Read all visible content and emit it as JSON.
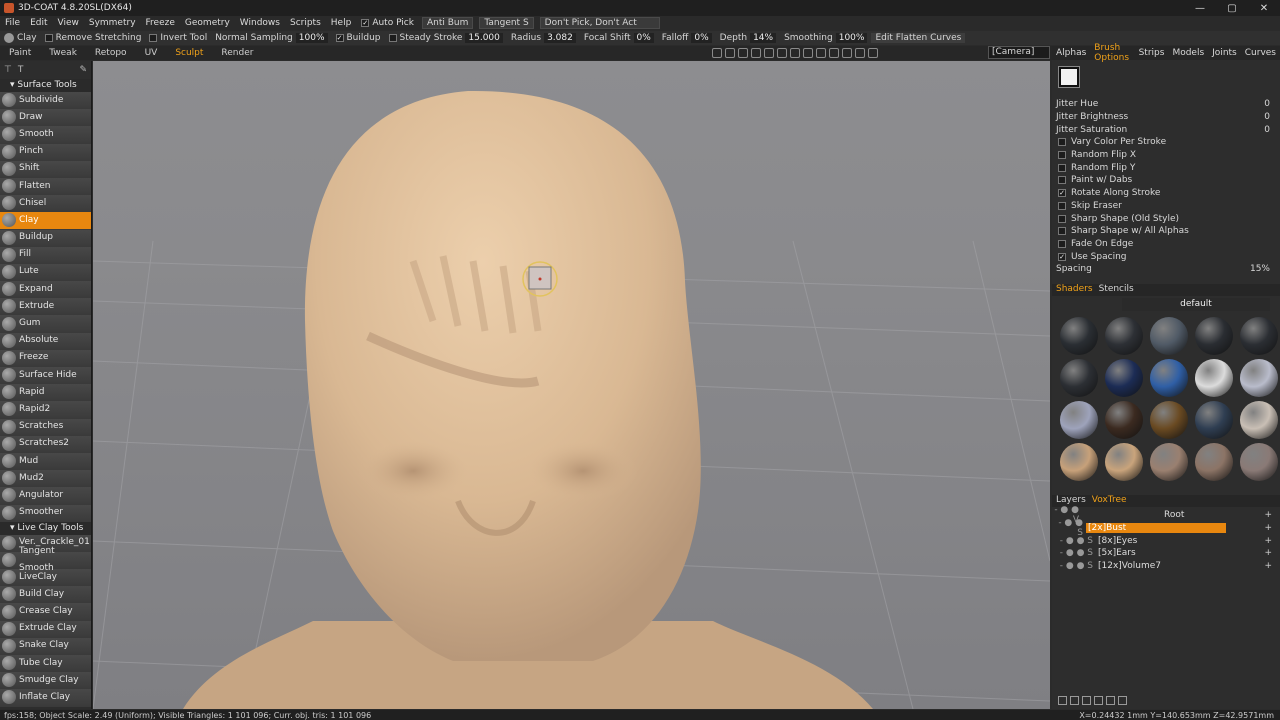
{
  "window": {
    "title": "3D-COAT 4.8.20SL(DX64)",
    "controls": [
      "—",
      "▢",
      "✕"
    ]
  },
  "menu": [
    "File",
    "Edit",
    "View",
    "Symmetry",
    "Freeze",
    "Geometry",
    "Windows",
    "Scripts",
    "Help"
  ],
  "menu_extra": {
    "auto_pick": "Auto Pick",
    "anti_bump": "Anti Bum",
    "tangent": "Tangent S",
    "pick_mode": "Don't Pick, Don't Act"
  },
  "tool_options": {
    "tool": "Clay",
    "remove_stretching": "Remove Stretching",
    "invert_tool": "Invert Tool",
    "normal_sampling": "Normal Sampling",
    "normal_sampling_val": "100%",
    "buildup": "Buildup",
    "steady_stroke": "Steady Stroke",
    "steady_stroke_val": "15.000",
    "radius": "Radius",
    "radius_val": "3.082",
    "focal_shift": "Focal Shift",
    "focal_shift_val": "0%",
    "falloff": "Falloff",
    "falloff_val": "0%",
    "depth": "Depth",
    "depth_val": "14%",
    "smoothing": "Smoothing",
    "smoothing_val": "100%",
    "edit_flatten": "Edit Flatten Curves"
  },
  "rooms": [
    "Paint",
    "Tweak",
    "Retopo",
    "UV",
    "Sculpt",
    "Render"
  ],
  "active_room": "Sculpt",
  "camera": "[Camera]",
  "left_panel": {
    "section1": "Surface Tools",
    "surface_tools": [
      "Subdivide",
      "Draw",
      "Smooth",
      "Pinch",
      "Shift",
      "Flatten",
      "Chisel",
      "Clay",
      "Buildup",
      "Fill",
      "Lute",
      "Expand",
      "Extrude",
      "Gum",
      "Absolute",
      "Freeze",
      "Surface Hide",
      "Rapid",
      "Rapid2",
      "Scratches",
      "Scratches2",
      "Mud",
      "Mud2",
      "Angulator",
      "Smoother"
    ],
    "active_tool": "Clay",
    "section2": "Live Clay Tools",
    "live_clay_tools": [
      "Ver._Crackle_01",
      "Tangent Smooth",
      "LiveClay",
      "Build Clay",
      "Crease Clay",
      "Extrude Clay",
      "Snake Clay",
      "Tube Clay",
      "Smudge Clay",
      "Inflate Clay"
    ]
  },
  "right_panel": {
    "tabs": [
      "Alphas",
      "Brush Options",
      "Strips",
      "Models",
      "Joints",
      "Curves"
    ],
    "active_tab": "Brush Options",
    "props": [
      {
        "label": "Jitter Hue",
        "value": "0"
      },
      {
        "label": "Jitter Brightness",
        "value": "0"
      },
      {
        "label": "Jitter Saturation",
        "value": "0"
      }
    ],
    "checks": [
      {
        "label": "Vary Color Per Stroke",
        "checked": false
      },
      {
        "label": "Random Flip X",
        "checked": false
      },
      {
        "label": "Random Flip Y",
        "checked": false
      },
      {
        "label": "Paint w/ Dabs",
        "checked": false
      },
      {
        "label": "Rotate Along Stroke",
        "checked": true
      },
      {
        "label": "Skip Eraser",
        "checked": false
      },
      {
        "label": "Sharp Shape (Old Style)",
        "checked": false
      },
      {
        "label": "Sharp Shape w/ All Alphas",
        "checked": false
      },
      {
        "label": "Fade On Edge",
        "checked": false
      },
      {
        "label": "Use Spacing",
        "checked": true
      }
    ],
    "spacing": {
      "label": "Spacing",
      "value": "15%"
    },
    "shader_tabs": [
      "Shaders",
      "Stencils"
    ],
    "shader_preset": "default",
    "shader_colors": [
      "#2a2e33",
      "#2d3035",
      "#505a66",
      "#2a2d32",
      "#2b2e33",
      "#2c2f34",
      "#1c2c55",
      "#2f5fa6",
      "#dcdcdc",
      "#b9bccb",
      "#9ea3bb",
      "#3b2a20",
      "#6a4a22",
      "#2f3e52",
      "#c9bfb5",
      "#c7a17a",
      "#c9a47c",
      "#9a8070",
      "#8c7466",
      "#8a7a76"
    ],
    "layer_tabs": [
      "Layers",
      "VoxTree"
    ],
    "active_layer_tab": "VoxTree",
    "tree": [
      {
        "label": "Root",
        "depth": 0
      },
      {
        "label": "[2x]Bust",
        "depth": 1,
        "selected": true
      },
      {
        "label": "[8x]Eyes",
        "depth": 2
      },
      {
        "label": "[5x]Ears",
        "depth": 2
      },
      {
        "label": "[12x]Volume7",
        "depth": 2
      }
    ]
  },
  "status": {
    "left": "fps:158;    Object Scale: 2.49 (Uniform); Visible Triangles: 1 101 096; Curr. obj. tris: 1 101 096",
    "right": "X=0.24432 1mm  Y=140.653mm  Z=42.9571mm"
  }
}
